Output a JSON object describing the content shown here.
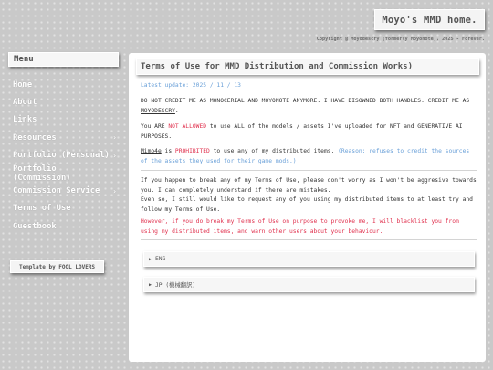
{
  "header": {
    "site_title": "Moyo's MMD home.",
    "copyright": "Copyright @ Moyodescry (formerly Moyonote), 2025 - Forever."
  },
  "sidebar": {
    "menu_title": "Menu",
    "items": [
      {
        "label": "Home",
        "chevron": ""
      },
      {
        "label": "About",
        "chevron": ""
      },
      {
        "label": "Links",
        "chevron": ""
      },
      {
        "label": "Resources",
        "chevron": "›"
      },
      {
        "label": "Portfolio (Personal)",
        "chevron": "›"
      },
      {
        "label": "Portfolio (Commission)",
        "chevron": ""
      },
      {
        "label": "Commission Service",
        "chevron": "›"
      },
      {
        "label": "Terms of Use",
        "chevron": ""
      },
      {
        "label": "Guestbook",
        "chevron": ""
      }
    ],
    "template_credit": "Template by FOOL LOVERS"
  },
  "main": {
    "title": "Terms of Use for MMD Distribution and Commission Works)",
    "latest_update": "Latest update: 2025 / 11 / 13",
    "p1_a": "DO NOT CREDIT ME AS MONOCEREAL AND MOYONOTE ANYMORE. I HAVE DISOWNED BOTH HANDLES. CREDIT ME AS ",
    "p1_b": "MOYODESCRY",
    "p1_c": ".",
    "p2_a": "You ARE ",
    "p2_b": "NOT ALLOWED",
    "p2_c": " to use ALL of the models / assets I've uploaded for NFT and GENERATIVE AI PURPOSES.",
    "p3_a": "Mimo4e",
    "p3_b": " is ",
    "p3_c": "PROHIBITED",
    "p3_d": " to use any of my distributed items. ",
    "p3_e": "(Reason: refuses to credit the sources of the assets they used for their game mods.)",
    "p4_l1": "If you happen to break any of my Terms of Use, please don't worry as I won't be aggresive towards you. I can completely understand if there are mistakes.",
    "p4_l2": "Even so, I still would like to request any of you using my distributed items to at least try and follow my Terms of Use.",
    "p5": "However, if you do break my Terms of Use on purpose to provoke me, I will blacklist you from using my distributed items, and warn other users about your behaviour.",
    "accordions": [
      {
        "label": "ENG"
      },
      {
        "label": "JP (機械翻訳)"
      }
    ]
  },
  "colors": {
    "accent_red": "#e0304d",
    "accent_blue": "#6aa0d8",
    "menu_text": "#ffffff",
    "background": "#c9c9c9"
  },
  "icons": {
    "submenu": "chevron-right-icon",
    "accordion": "triangle-right-icon"
  }
}
